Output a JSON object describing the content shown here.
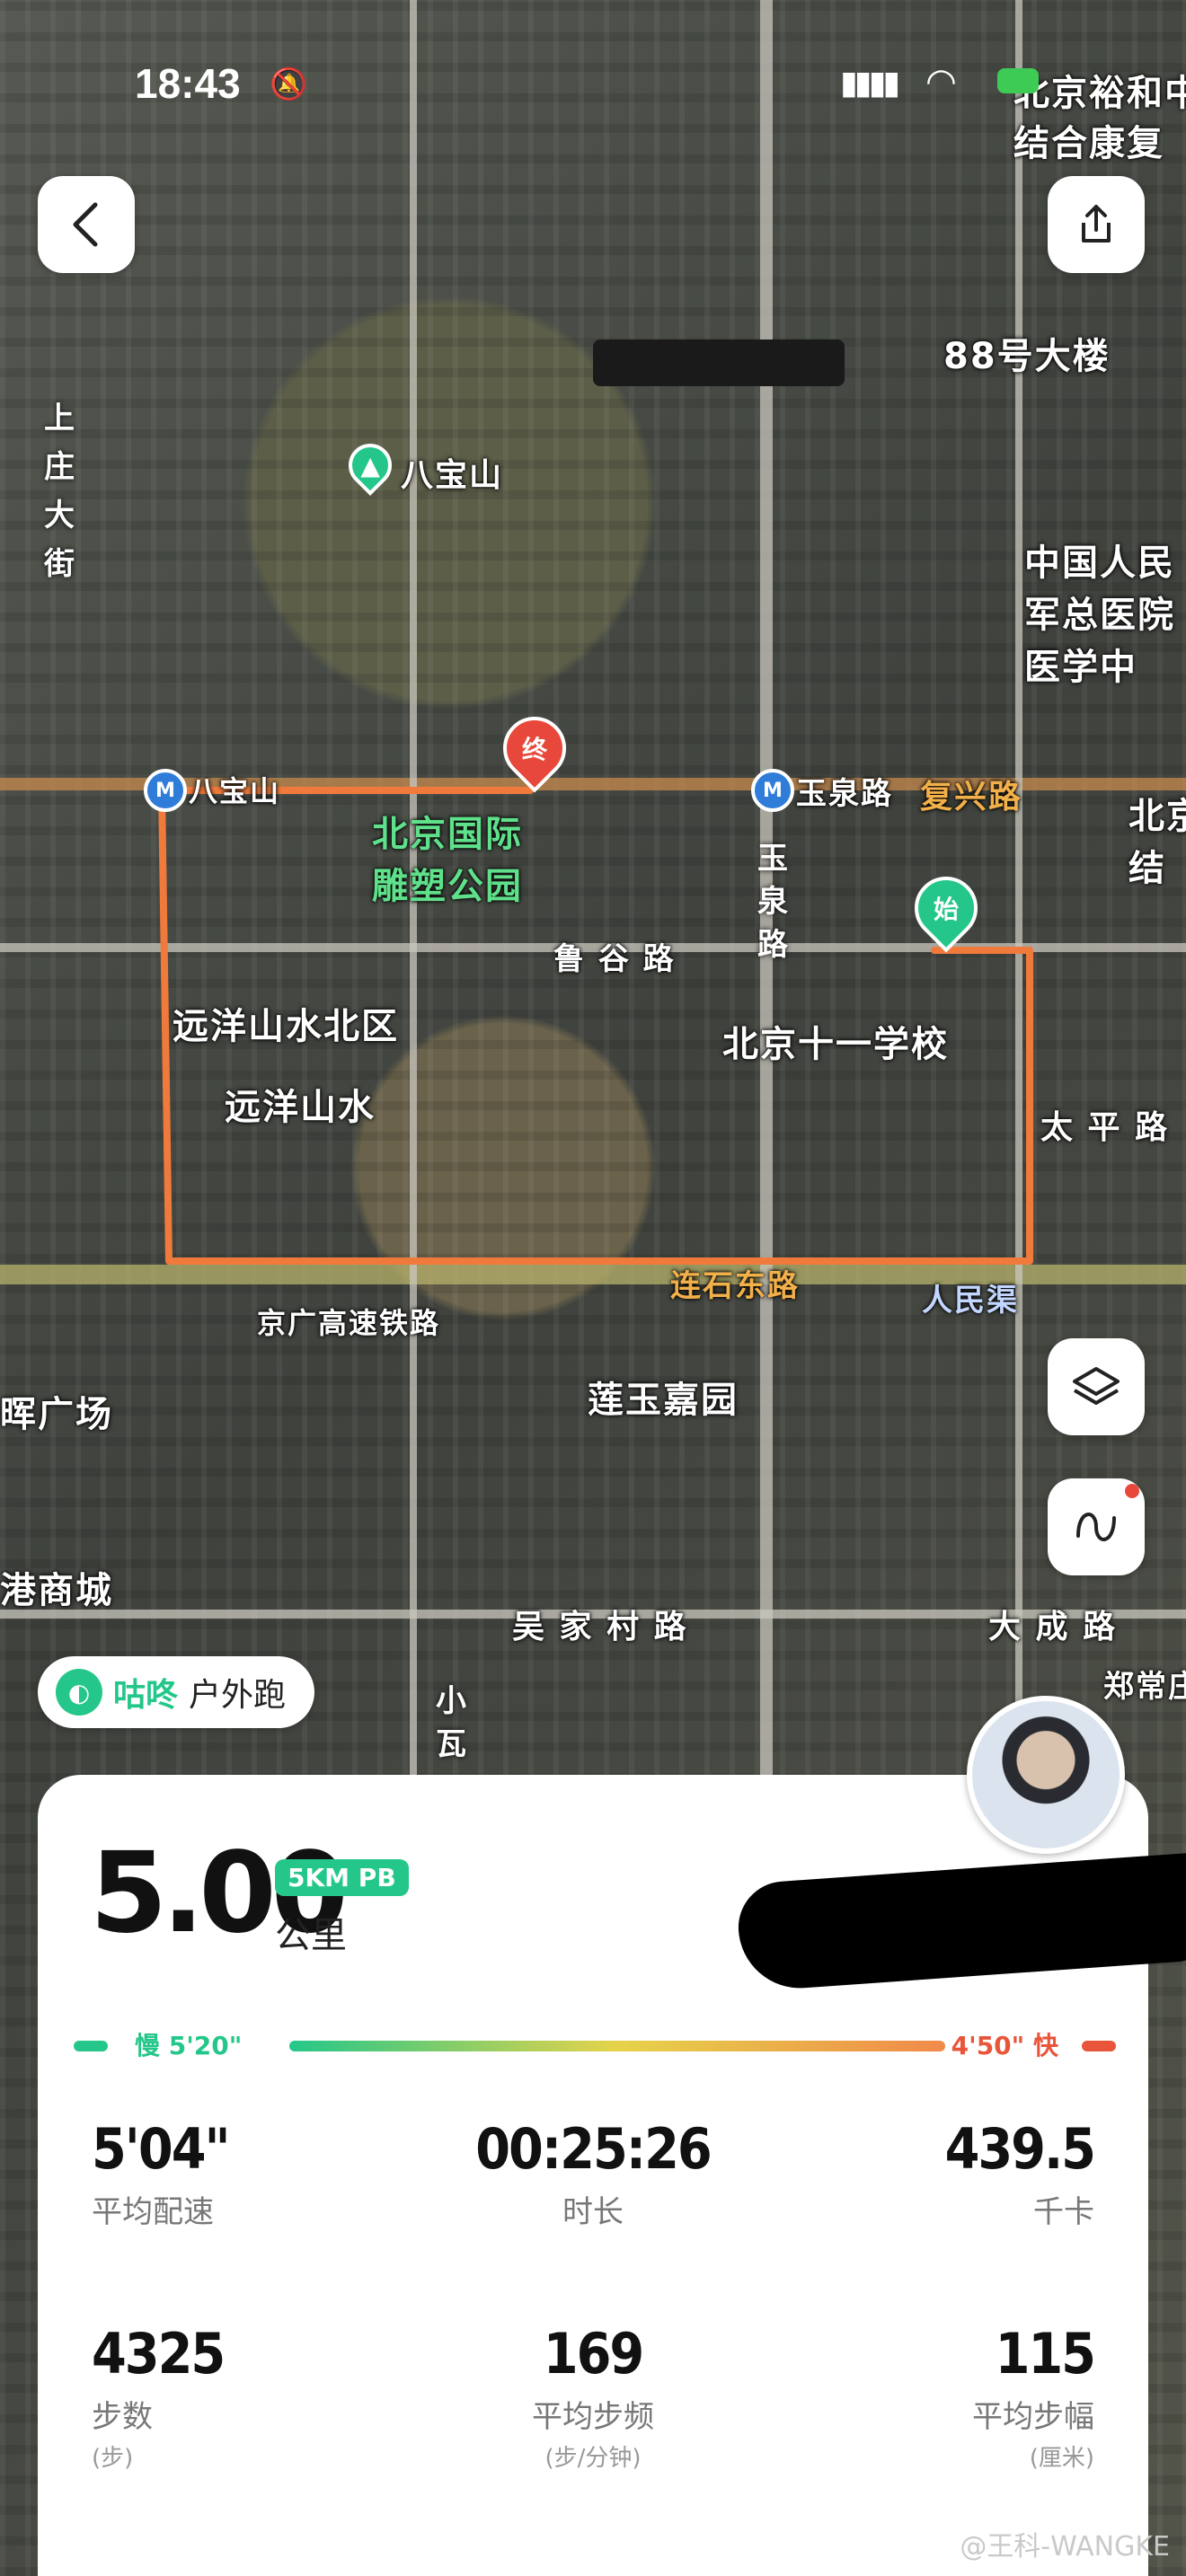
{
  "status": {
    "time": "18:43"
  },
  "map_labels": {
    "top_right_poi": "北京裕和中\n结合康复",
    "building_88": "88号大楼",
    "babaoshan": "八宝山",
    "shangzhuang_street": [
      "上",
      "庄",
      "大",
      "街"
    ],
    "hospital": "中国人民\n军总医院\n医学中",
    "metro_babaoshan": "八宝山",
    "metro_yuquanlu": "玉泉路",
    "fuxing_road": "复兴路",
    "beijing_right": "北京\n结",
    "sculpture_park": "北京国际\n雕塑公园",
    "yuquan_road_vertical": [
      "玉",
      "泉",
      "路"
    ],
    "lugu_road": "鲁 谷 路",
    "yuanyang_north": "远洋山水北区",
    "yuanyang": "远洋山水",
    "school": "北京十一学校",
    "taiping_road": "太 平 路",
    "lianshi_east": "连石东路",
    "renminqu": "人民渠",
    "jingguang_rail": "京广高速铁路",
    "plaza_left": "晖广场",
    "lianyu_garden": "莲玉嘉园",
    "mall_left": "港商城",
    "wujiacun_road": "吴 家 村 路",
    "dacheng_road": "大 成 路",
    "xiaowa": [
      "小",
      "瓦"
    ],
    "zhengchang": "郑常庄",
    "pin_end": "终",
    "pin_start": "始"
  },
  "app": {
    "name": "咕咚",
    "type": "户外跑"
  },
  "summary": {
    "distance": "5.00",
    "badge": "5KM PB",
    "unit": "公里"
  },
  "pace": {
    "slow": "慢 5'20\"",
    "fast": "4'50\" 快"
  },
  "stats": [
    {
      "value": "5'04\"",
      "label": "平均配速",
      "sub": ""
    },
    {
      "value": "00:25:26",
      "label": "时长",
      "sub": ""
    },
    {
      "value": "439.5",
      "label": "千卡",
      "sub": ""
    },
    {
      "value": "4325",
      "label": "步数",
      "sub": "(步)"
    },
    {
      "value": "169",
      "label": "平均步频",
      "sub": "(步/分钟)"
    },
    {
      "value": "115",
      "label": "平均步幅",
      "sub": "(厘米)"
    }
  ],
  "watermark": "@王科-WANGKE",
  "icons": [
    "back-icon",
    "share-icon",
    "layers-icon",
    "route-icon",
    "bell-off-icon",
    "signal-icon",
    "wifi-icon",
    "battery-icon"
  ],
  "colors": {
    "route": "#f07a3c",
    "brand": "#24c789",
    "end_pin": "#e8483b",
    "start_pin": "#24c789"
  }
}
